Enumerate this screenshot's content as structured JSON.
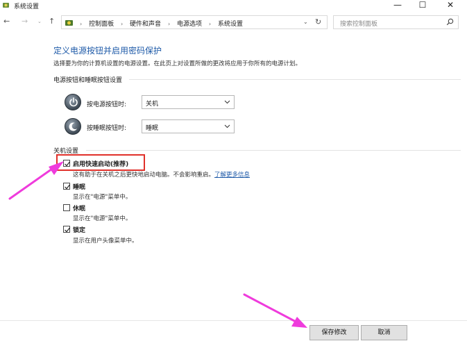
{
  "window": {
    "title": "系统设置",
    "minimize": "—",
    "maximize": "☐",
    "close": "✕"
  },
  "nav": {
    "back": "←",
    "forward": "→",
    "history": "⌄",
    "up": "↑",
    "breadcrumbs": [
      "控制面板",
      "硬件和声音",
      "电源选项",
      "系统设置"
    ],
    "separator": "›",
    "dropdown": "⌄",
    "refresh": "↻"
  },
  "search": {
    "placeholder": "搜索控制面板"
  },
  "content": {
    "title": "定义电源按钮并启用密码保护",
    "description": "选择要为你的计算机设置的电源设置。在此页上对设置所做的更改将应用于你所有的电源计划。",
    "section_buttons": "电源按钮和睡眠按钮设置",
    "power_button_label": "按电源按钮时:",
    "power_button_value": "关机",
    "sleep_button_label": "按睡眠按钮时:",
    "sleep_button_value": "睡眠",
    "section_shutdown": "关机设置",
    "options": [
      {
        "label": "启用快速启动(推荐)",
        "checked": true,
        "description": "这有助于在关机之后更快地启动电脑。不会影响重启。",
        "link": "了解更多信息"
      },
      {
        "label": "睡眠",
        "checked": true,
        "description": "显示在\"电源\"菜单中。"
      },
      {
        "label": "休眠",
        "checked": false,
        "description": "显示在\"电源\"菜单中。"
      },
      {
        "label": "锁定",
        "checked": true,
        "description": "显示在用户头像菜单中。"
      }
    ]
  },
  "footer": {
    "save": "保存修改",
    "cancel": "取消"
  },
  "colors": {
    "title_blue": "#1e5aa8",
    "highlight_red": "#e0302a",
    "arrow_magenta": "#ef3bdc"
  },
  "icons": {
    "app": "settings-shield-icon",
    "power": "power-icon",
    "sleep": "moon-icon",
    "search": "search-icon",
    "dropdown": "chevron-down-icon"
  }
}
